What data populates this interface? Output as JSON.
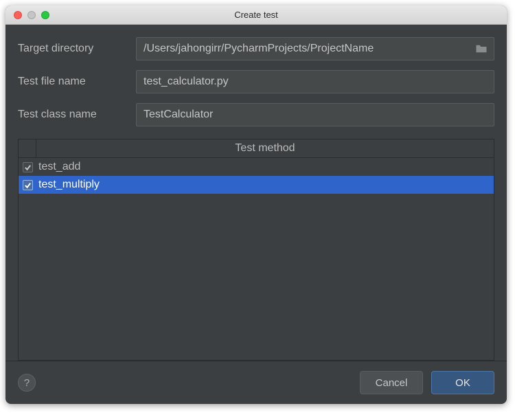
{
  "window": {
    "title": "Create test"
  },
  "form": {
    "target_dir_label": "Target directory",
    "target_dir_value": "/Users/jahongirr/PycharmProjects/ProjectName",
    "test_file_label": "Test file name",
    "test_file_value": "test_calculator.py",
    "test_class_label": "Test class name",
    "test_class_value": "TestCalculator"
  },
  "method_panel": {
    "header": "Test method",
    "items": [
      {
        "label": "test_add",
        "checked": true,
        "selected": false
      },
      {
        "label": "test_multiply",
        "checked": true,
        "selected": true
      }
    ]
  },
  "buttons": {
    "help": "?",
    "cancel": "Cancel",
    "ok": "OK"
  },
  "icons": {
    "folder": "folder-icon",
    "check": "checkmark-icon"
  },
  "colors": {
    "selection": "#2f65ca",
    "panel_bg": "#3c3f41",
    "input_bg": "#45494a",
    "btn_primary": "#365880"
  }
}
